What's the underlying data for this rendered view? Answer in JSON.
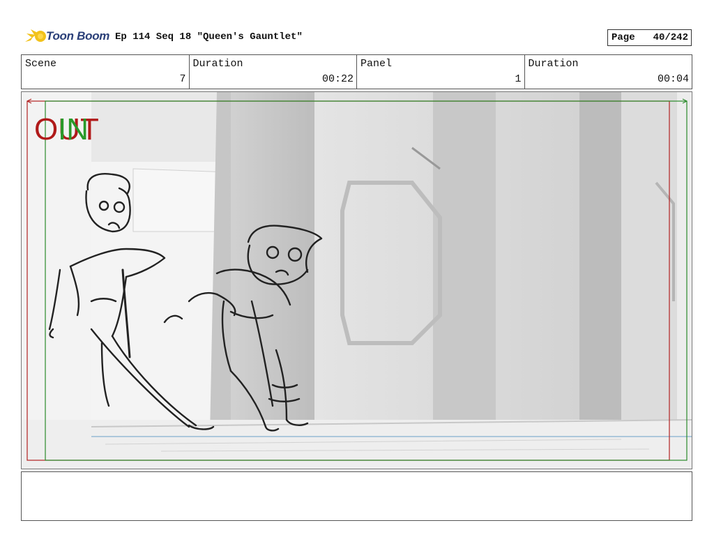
{
  "header": {
    "brand": "Toon Boom",
    "title": "Ep 114 Seq 18 \"Queen's Gauntlet\"",
    "page_label": "Page",
    "page_value": "40/242"
  },
  "info": {
    "scene_label": "Scene",
    "scene_value": "7",
    "duration_label": "Duration",
    "duration_value": "00:22",
    "panel_label": "Panel",
    "panel_value": "1",
    "panel_duration_label": "Duration",
    "panel_duration_value": "00:04"
  },
  "frame_markers": {
    "in_label": "IN",
    "out_label": "OUT",
    "in_color": "#2a9a2a",
    "out_color": "#b01a1a"
  },
  "notes": {
    "text": ""
  }
}
